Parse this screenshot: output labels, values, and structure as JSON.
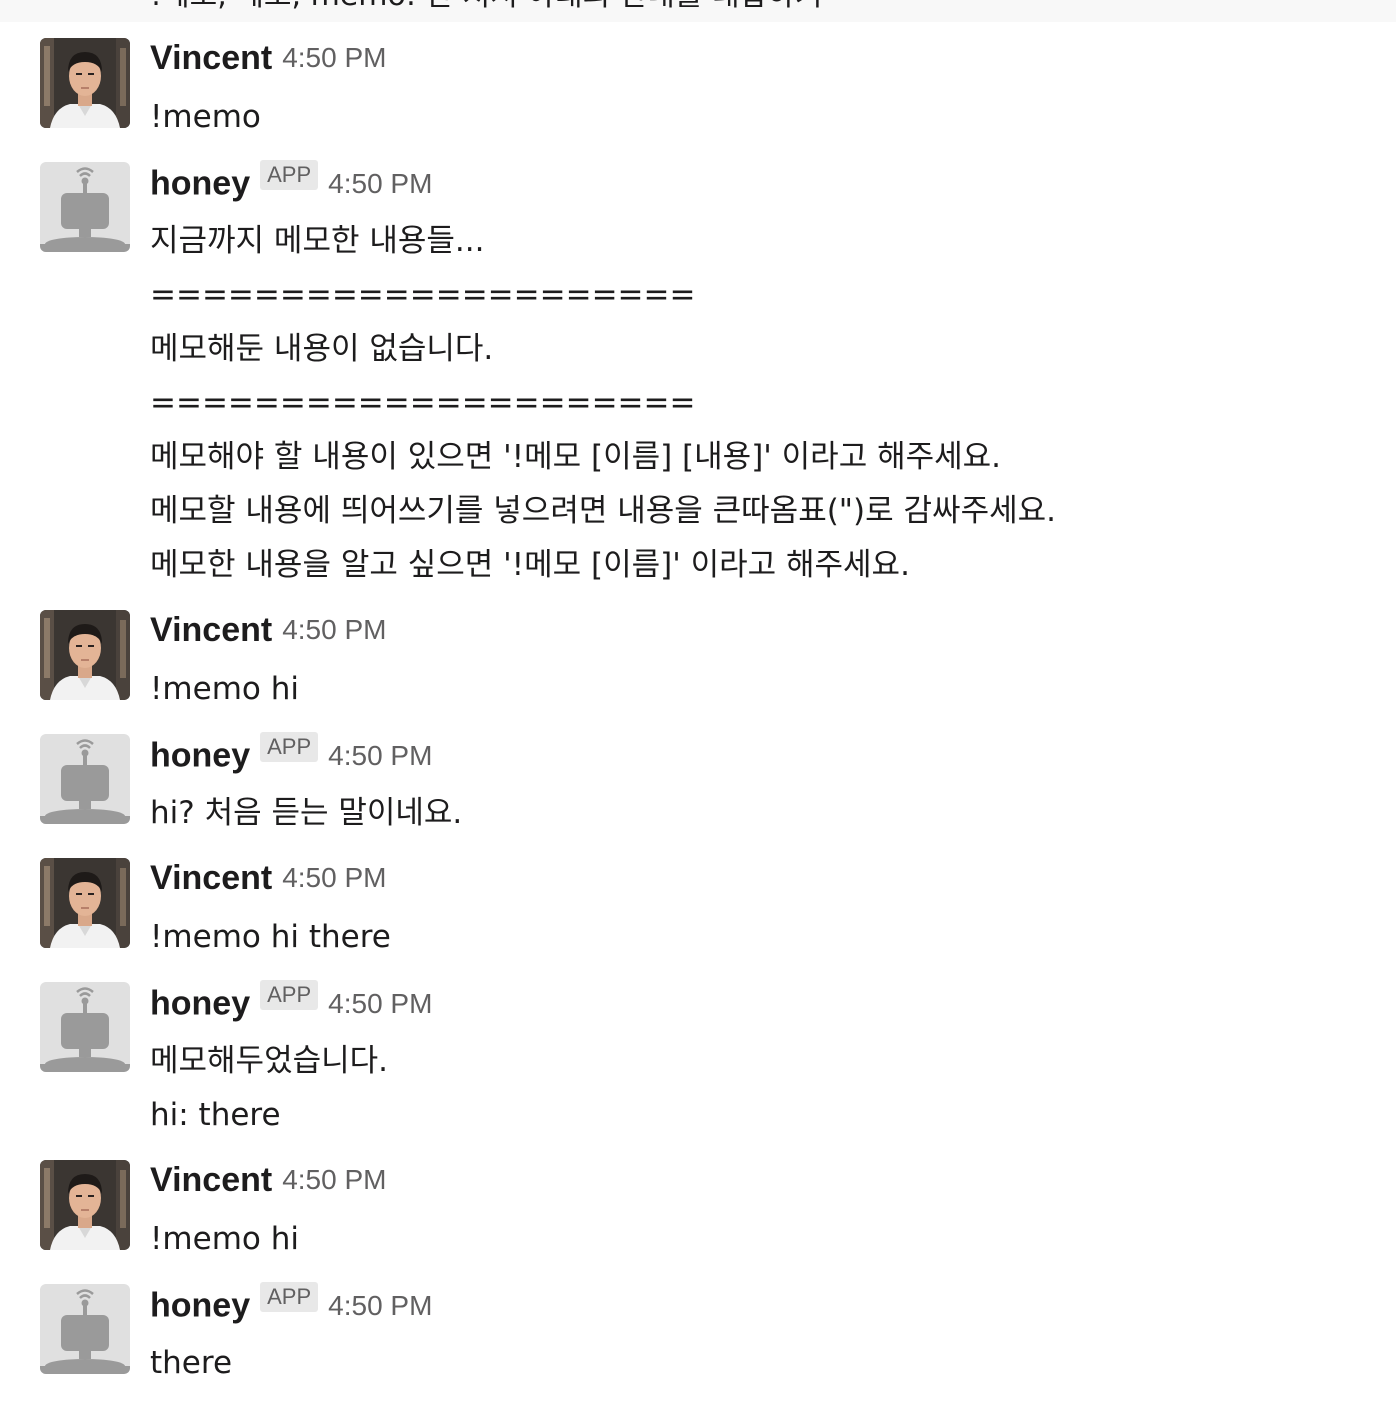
{
  "top_strip": {
    "text": "!메모, 메모, memo: 만 쳐서 아래의 안내를 대답하기"
  },
  "labels": {
    "app_badge": "APP"
  },
  "messages": [
    {
      "author": "Vincent",
      "is_app": false,
      "time": "4:50 PM",
      "lines": [
        "!memo"
      ]
    },
    {
      "author": "honey",
      "is_app": true,
      "time": "4:50 PM",
      "lines": [
        "지금까지 메모한 내용들...",
        "=====================",
        "메모해둔 내용이 없습니다.",
        "=====================",
        "메모해야 할 내용이 있으면 '!메모 [이름] [내용]' 이라고 해주세요.",
        "메모할 내용에 띄어쓰기를 넣으려면 내용을 큰따옴표(\")로 감싸주세요.",
        "메모한 내용을 알고 싶으면 '!메모 [이름]' 이라고 해주세요."
      ]
    },
    {
      "author": "Vincent",
      "is_app": false,
      "time": "4:50 PM",
      "lines": [
        "!memo hi"
      ]
    },
    {
      "author": "honey",
      "is_app": true,
      "time": "4:50 PM",
      "lines": [
        "hi? 처음 듣는 말이네요."
      ]
    },
    {
      "author": "Vincent",
      "is_app": false,
      "time": "4:50 PM",
      "lines": [
        "!memo hi there"
      ]
    },
    {
      "author": "honey",
      "is_app": true,
      "time": "4:50 PM",
      "lines": [
        "메모해두었습니다.",
        "hi: there"
      ]
    },
    {
      "author": "Vincent",
      "is_app": false,
      "time": "4:50 PM",
      "lines": [
        "!memo hi"
      ]
    },
    {
      "author": "honey",
      "is_app": true,
      "time": "4:50 PM",
      "lines": [
        "there"
      ]
    }
  ],
  "colors": {
    "text": "#1d1c1d",
    "muted": "#616061",
    "badge_bg": "#e8e8e8",
    "bot_avatar_bg": "#e0e0e0",
    "bot_avatar_fg": "#9a9a9a"
  },
  "icons": {
    "user_avatar": "person-photo-avatar",
    "bot_avatar": "robot-avatar"
  }
}
